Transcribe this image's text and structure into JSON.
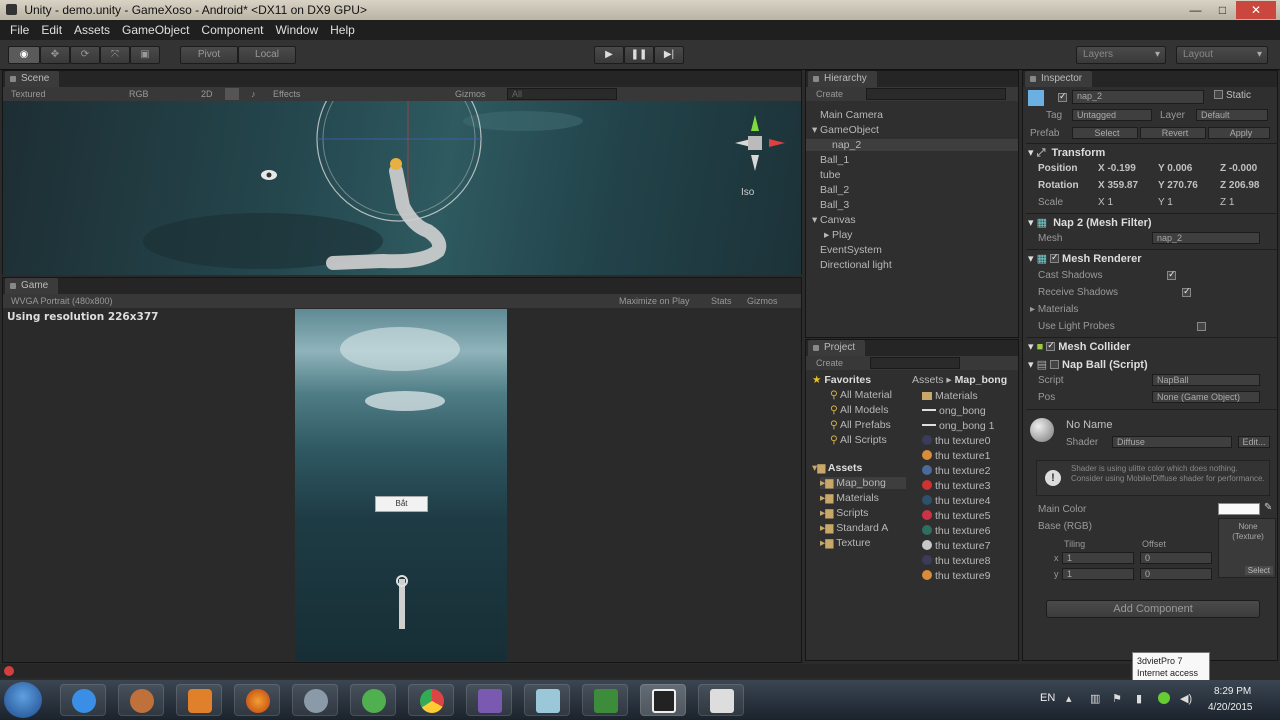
{
  "window": {
    "title": "Unity - demo.unity - GameXoso - Android* <DX11 on DX9 GPU>"
  },
  "menu": [
    "File",
    "Edit",
    "Assets",
    "GameObject",
    "Component",
    "Window",
    "Help"
  ],
  "toolbar": {
    "pivot": "Pivot",
    "local": "Local",
    "layers": "Layers",
    "layout": "Layout"
  },
  "scene": {
    "tab": "Scene",
    "shading": "Textured",
    "rgb": "RGB",
    "mode2d": "2D",
    "effects": "Effects",
    "gizmos": "Gizmos",
    "search_placeholder": "All",
    "persp": "Iso"
  },
  "game": {
    "tab": "Game",
    "aspect": "WVGA Portrait (480x800)",
    "maximize": "Maximize on Play",
    "stats": "Stats",
    "gizmos": "Gizmos",
    "resolution": "Using resolution 226x377",
    "button_label": "Bắt"
  },
  "hierarchy": {
    "tab": "Hierarchy",
    "create": "Create",
    "items": [
      {
        "label": "Main Camera",
        "indent": 0,
        "arrow": ""
      },
      {
        "label": "GameObject",
        "indent": 0,
        "arrow": "▾"
      },
      {
        "label": "nap_2",
        "indent": 1,
        "arrow": ""
      },
      {
        "label": "Ball_1",
        "indent": 0,
        "arrow": ""
      },
      {
        "label": "tube",
        "indent": 0,
        "arrow": ""
      },
      {
        "label": "Ball_2",
        "indent": 0,
        "arrow": ""
      },
      {
        "label": "Ball_3",
        "indent": 0,
        "arrow": ""
      },
      {
        "label": "Canvas",
        "indent": 0,
        "arrow": "▾"
      },
      {
        "label": "Play",
        "indent": 1,
        "arrow": "▸"
      },
      {
        "label": "EventSystem",
        "indent": 0,
        "arrow": ""
      },
      {
        "label": "Directional light",
        "indent": 0,
        "arrow": ""
      }
    ]
  },
  "project": {
    "tab": "Project",
    "create": "Create",
    "favorites_title": "Favorites",
    "favorites": [
      "All Material",
      "All Models",
      "All Prefabs",
      "All Scripts"
    ],
    "assets_title": "Assets",
    "folders": [
      "Map_bong",
      "Materials",
      "Scripts",
      "Standard A",
      "Texture"
    ],
    "breadcrumb": [
      "Assets",
      "Map_bong"
    ],
    "files": [
      {
        "label": "Materials",
        "kind": "folder"
      },
      {
        "label": "ong_bong",
        "kind": "mesh"
      },
      {
        "label": "ong_bong 1",
        "kind": "mesh"
      },
      {
        "label": "thu texture0",
        "kind": "mat",
        "color": "#3b3b5c"
      },
      {
        "label": "thu texture1",
        "kind": "mat",
        "color": "#d98c3a"
      },
      {
        "label": "thu texture2",
        "kind": "mat",
        "color": "#4a6a9a"
      },
      {
        "label": "thu texture3",
        "kind": "mat",
        "color": "#cc3333"
      },
      {
        "label": "thu texture4",
        "kind": "mat",
        "color": "#2f4f6f"
      },
      {
        "label": "thu texture5",
        "kind": "mat",
        "color": "#cc3344"
      },
      {
        "label": "thu texture6",
        "kind": "mat",
        "color": "#2f6f5f"
      },
      {
        "label": "thu texture7",
        "kind": "mat",
        "color": "#c8c8c8"
      },
      {
        "label": "thu texture8",
        "kind": "mat",
        "color": "#3b3b5c"
      },
      {
        "label": "thu texture9",
        "kind": "mat",
        "color": "#d98c3a"
      }
    ]
  },
  "inspector": {
    "tab": "Inspector",
    "object_name": "nap_2",
    "static": "Static",
    "tag_label": "Tag",
    "tag_value": "Untagged",
    "layer_label": "Layer",
    "layer_value": "Default",
    "prefab_label": "Prefab",
    "prefab_select": "Select",
    "prefab_revert": "Revert",
    "prefab_apply": "Apply",
    "transform": {
      "title": "Transform",
      "position_label": "Position",
      "position": [
        "X -0.199",
        "Y 0.006",
        "Z -0.000"
      ],
      "rotation_label": "Rotation",
      "rotation": [
        "X 359.87",
        "Y 270.76",
        "Z 206.98"
      ],
      "scale_label": "Scale",
      "scale": [
        "X 1",
        "Y 1",
        "Z 1"
      ]
    },
    "mesh_filter": {
      "title": "Nap 2 (Mesh Filter)",
      "mesh_label": "Mesh",
      "mesh_value": "nap_2"
    },
    "mesh_renderer": {
      "title": "Mesh Renderer",
      "cast_shadows": "Cast Shadows",
      "receive_shadows": "Receive Shadows",
      "materials": "Materials",
      "light_probes": "Use Light Probes"
    },
    "mesh_collider": {
      "title": "Mesh Collider"
    },
    "script": {
      "title": "Nap Ball (Script)",
      "script_label": "Script",
      "script_value": "NapBall",
      "pos_label": "Pos",
      "pos_value": "None (Game Object)"
    },
    "material": {
      "name": "No Name",
      "shader_label": "Shader",
      "shader_value": "Diffuse",
      "edit": "Edit...",
      "info": "Shader is using ulitte color which does nothing. Consider using Mobile/Diffuse shader for performance.",
      "main_color": "Main Color",
      "base": "Base (RGB)",
      "tiling": "Tiling",
      "offset": "Offset",
      "tiling_x": "1",
      "tiling_y": "1",
      "offset_x": "0",
      "offset_y": "0",
      "texture_none": "None (Texture)",
      "select": "Select"
    },
    "add_component": "Add Component"
  },
  "tooltip": {
    "line1": "3dvietPro 7",
    "line2": "Internet access"
  },
  "tray": {
    "lang": "EN",
    "time": "8:29 PM",
    "date": "4/20/2015"
  }
}
